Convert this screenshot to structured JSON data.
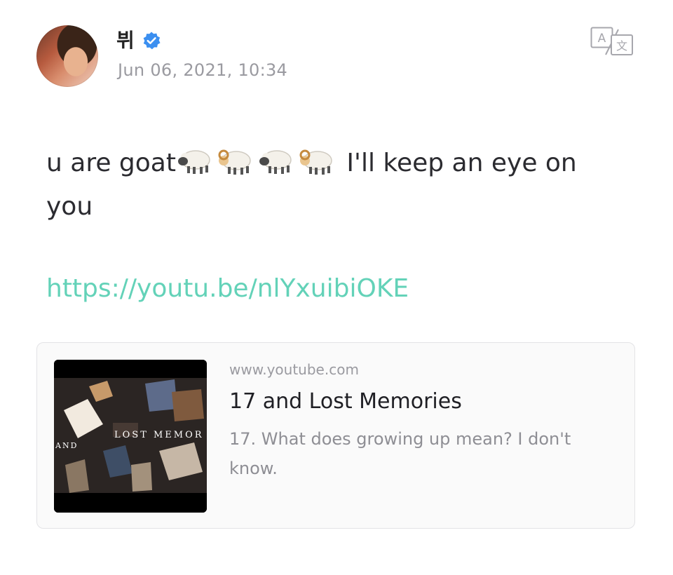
{
  "post": {
    "author_name": "뷔",
    "date": "Jun 06, 2021, 10:34",
    "text_before": "u are goat",
    "emojis": [
      "sheep-emoji",
      "ram-emoji",
      "sheep-emoji",
      "ram-emoji"
    ],
    "text_after": " I'll keep an eye on you",
    "link": "https://youtu.be/nlYxuibiOKE"
  },
  "link_card": {
    "domain": "www.youtube.com",
    "title": "17 and Lost Memories",
    "description": "17. What does growing up mean? I don't know.",
    "thumbnail_text_main": "LOST MEMOR",
    "thumbnail_text_left": "AND"
  },
  "colors": {
    "link": "#63d2b8",
    "verified": "#3b8ff0",
    "muted": "#9a9aa0"
  },
  "icons": {
    "verified": "verified-badge-icon",
    "translate": "translate-icon"
  }
}
